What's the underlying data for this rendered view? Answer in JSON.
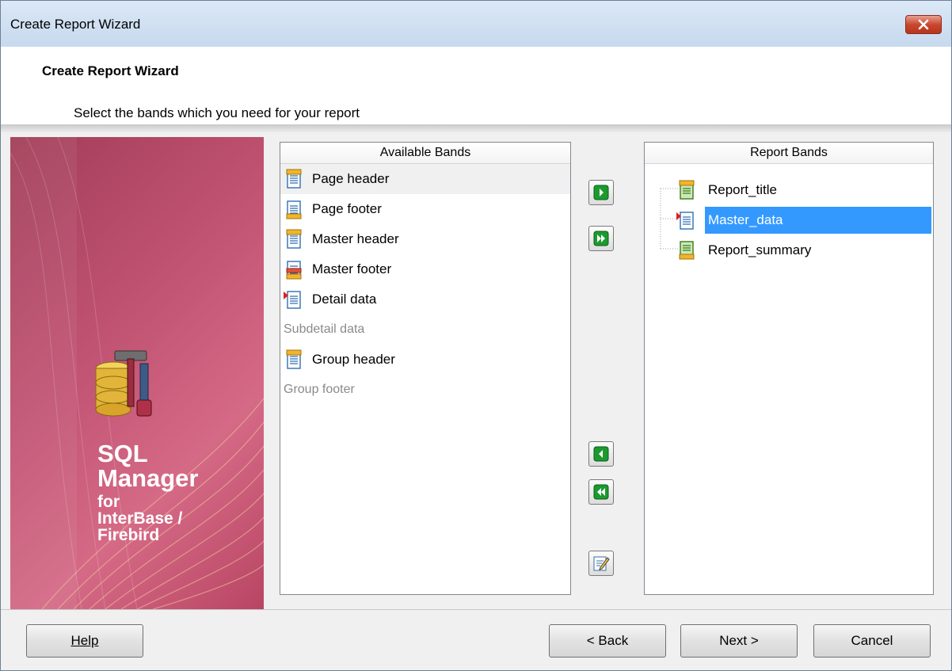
{
  "window": {
    "title": "Create Report Wizard"
  },
  "header": {
    "title": "Create Report Wizard",
    "subtitle": "Select the bands which you need for your report"
  },
  "banner": {
    "line1": "SQL",
    "line2": "Manager",
    "line3": "for",
    "line4": "InterBase /",
    "line5": "Firebird"
  },
  "available_bands": {
    "header": "Available Bands",
    "items": [
      {
        "label": "Page header",
        "icon": "band-header-icon",
        "enabled": true
      },
      {
        "label": "Page footer",
        "icon": "band-footer-icon",
        "enabled": true
      },
      {
        "label": "Master header",
        "icon": "band-header-icon",
        "enabled": true
      },
      {
        "label": "Master footer",
        "icon": "band-footer-red-icon",
        "enabled": true
      },
      {
        "label": "Detail data",
        "icon": "band-data-icon",
        "enabled": true
      },
      {
        "label": "Subdetail data",
        "icon": "",
        "enabled": false
      },
      {
        "label": "Group header",
        "icon": "band-header-icon",
        "enabled": true
      },
      {
        "label": "Group footer",
        "icon": "",
        "enabled": false
      }
    ]
  },
  "report_bands": {
    "header": "Report Bands",
    "items": [
      {
        "label": "Report_title",
        "icon": "band-title-icon",
        "selected": false
      },
      {
        "label": "Master_data",
        "icon": "band-data-icon",
        "selected": true
      },
      {
        "label": "Report_summary",
        "icon": "band-summary-icon",
        "selected": false
      }
    ]
  },
  "buttons": {
    "help": "Help",
    "back": "< Back",
    "next": "Next >",
    "cancel": "Cancel"
  },
  "colors": {
    "selection": "#3399ff",
    "banner": "#c05272",
    "move_button_green": "#1c9a2e"
  }
}
